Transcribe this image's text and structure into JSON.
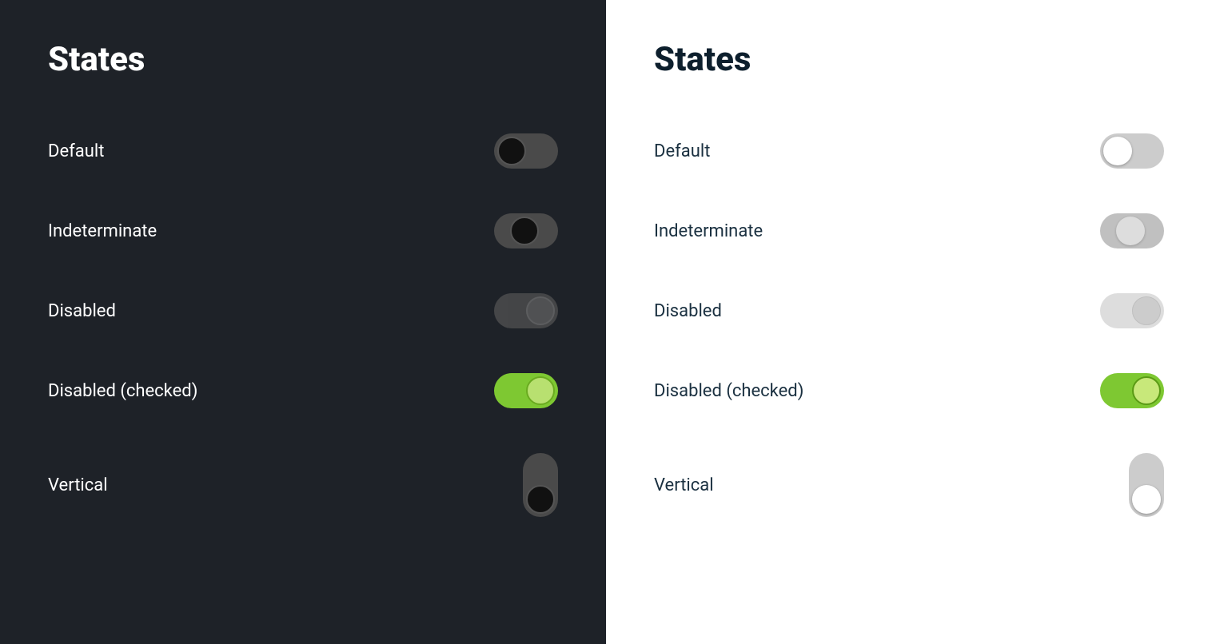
{
  "dark_panel": {
    "title": "States",
    "rows": [
      {
        "id": "default",
        "label": "Default"
      },
      {
        "id": "indeterminate",
        "label": "Indeterminate"
      },
      {
        "id": "disabled",
        "label": "Disabled"
      },
      {
        "id": "disabled-checked",
        "label": "Disabled (checked)"
      },
      {
        "id": "vertical",
        "label": "Vertical"
      }
    ]
  },
  "light_panel": {
    "title": "States",
    "rows": [
      {
        "id": "default",
        "label": "Default"
      },
      {
        "id": "indeterminate",
        "label": "Indeterminate"
      },
      {
        "id": "disabled",
        "label": "Disabled"
      },
      {
        "id": "disabled-checked",
        "label": "Disabled (checked)"
      },
      {
        "id": "vertical",
        "label": "Vertical"
      }
    ]
  }
}
